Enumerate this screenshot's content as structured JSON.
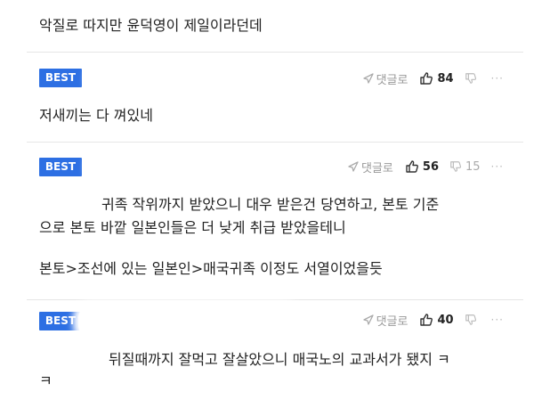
{
  "comments": [
    {
      "badge": "",
      "text_lines": [
        "악질로 따지만 윤덕영이 제일이라던데"
      ]
    },
    {
      "badge": "BEST",
      "reply_label": "댓글로",
      "likes": "84",
      "dislikes": "",
      "more": "···",
      "text_lines": [
        "저새끼는 다 껴있네"
      ]
    },
    {
      "badge": "BEST",
      "reply_label": "댓글로",
      "likes": "56",
      "dislikes": "15",
      "more": "···",
      "text_lines": [
        "귀족 작위까지 받았으니 대우 받은건 당연하고, 본토 기준",
        "으로 본토 바깥 일본인들은 더 낮게 취급 받았을테니",
        "",
        "본토>조선에 있는 일본인>매국귀족 이정도 서열이었을듯"
      ]
    },
    {
      "badge": "BEST",
      "reply_label": "댓글로",
      "likes": "40",
      "dislikes": "",
      "more": "···",
      "text_lines": [
        "뒤질때까지 잘먹고 잘살았으니 매국노의 교과서가 됐지 ㅋ",
        "ㅋ"
      ]
    }
  ],
  "colors": {
    "best_badge": "#2d6fe3",
    "separator": "#e6e6e6",
    "meta_gray": "#999999"
  }
}
